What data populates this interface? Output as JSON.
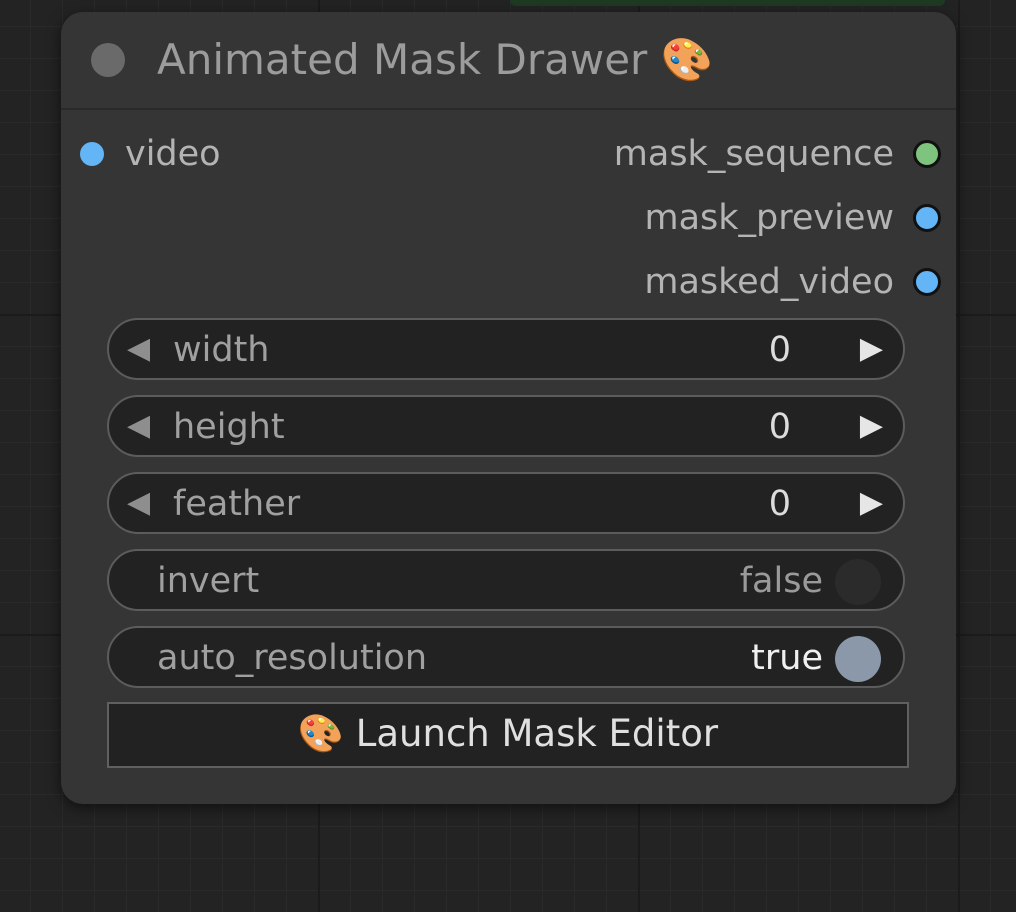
{
  "node": {
    "title": "Animated Mask Drawer 🎨",
    "inputs": [
      {
        "label": "video",
        "color": "#64b5f6"
      }
    ],
    "outputs": [
      {
        "label": "mask_sequence",
        "color": "#7ec47e"
      },
      {
        "label": "mask_preview",
        "color": "#64b5f6"
      },
      {
        "label": "masked_video",
        "color": "#64b5f6"
      }
    ],
    "widgets": {
      "width": {
        "label": "width",
        "value": "0"
      },
      "height": {
        "label": "height",
        "value": "0"
      },
      "feather": {
        "label": "feather",
        "value": "0"
      },
      "invert": {
        "label": "invert",
        "value": "false",
        "knob_color": "#2b2b2b"
      },
      "auto_resolution": {
        "label": "auto_resolution",
        "value": "true",
        "knob_color": "#8a98aa"
      }
    },
    "launch_button": {
      "label": "🎨 Launch Mask Editor"
    }
  },
  "icons": {
    "decrement": "left-triangle",
    "increment": "right-triangle"
  }
}
